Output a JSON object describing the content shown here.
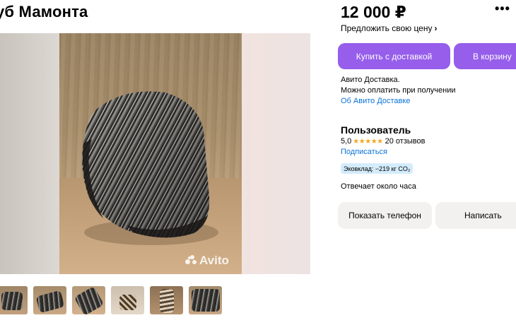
{
  "listing": {
    "title": "уб Мамонта",
    "price": "12 000 ₽",
    "more_label": "•••",
    "offer_price_label": "Предложить свою цену",
    "offer_chevron": "›"
  },
  "gallery": {
    "watermark": "Avito",
    "thumbnail_count": 6
  },
  "actions": {
    "buy_label": "Купить с доставкой",
    "cart_label": "В корзину",
    "phone_label": "Показать телефон",
    "write_label": "Написать"
  },
  "delivery": {
    "line1": "Авито Доставка.",
    "line2": "Можно оплатить при получении",
    "link": "Об Авито Доставке"
  },
  "seller": {
    "name": "Пользователь",
    "rating": "5,0",
    "stars": "★★★★★",
    "reviews": "20 отзывов",
    "subscribe_label": "Подписаться",
    "eco_badge": "Эковклад: −219 кг CO₂",
    "response_time": "Отвечает около часа"
  },
  "colors": {
    "accent": "#965eeb",
    "link": "#0a73d9",
    "star": "#f5a623",
    "eco_badge_bg": "#d4ecfb",
    "secondary_button_bg": "#f2f1f0"
  }
}
